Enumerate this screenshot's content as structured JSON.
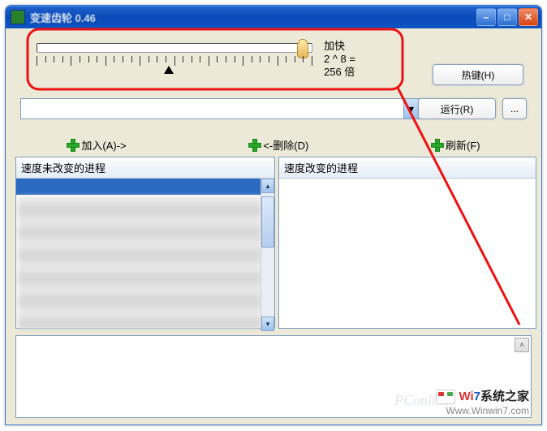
{
  "window": {
    "title": "变速齿轮 0.46",
    "buttons": {
      "min": "–",
      "max": "□",
      "close": "✕"
    }
  },
  "speed": {
    "label_fast": "加快",
    "formula": "2 ^ 8 =",
    "result": "256 倍"
  },
  "buttons": {
    "hotkey": "热键(H)",
    "run": "运行(R)",
    "dots": "..."
  },
  "combo": {
    "value": ""
  },
  "actions": {
    "add": "加入(A)->",
    "remove": "<-删除(D)",
    "refresh": "刷新(F)"
  },
  "panels": {
    "left_title": "速度未改变的进程",
    "right_title": "速度改变的进程"
  },
  "watermark": {
    "brand_a": "Wi",
    "brand_b": "7",
    "brand_c": "系统之家",
    "url": "Www.Winwin7.com",
    "pconline": "PConline"
  }
}
